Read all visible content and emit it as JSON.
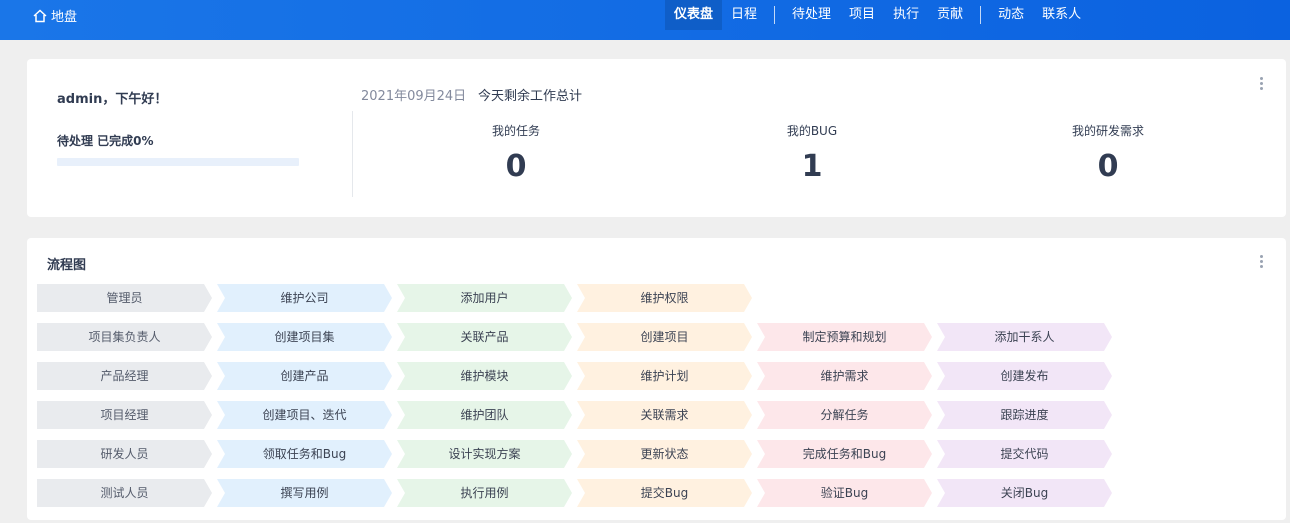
{
  "header": {
    "brand": "地盘",
    "nav": [
      {
        "label": "仪表盘",
        "active": true
      },
      {
        "label": "日程"
      },
      {
        "sep": true
      },
      {
        "label": "待处理"
      },
      {
        "label": "项目"
      },
      {
        "label": "执行"
      },
      {
        "label": "贡献"
      },
      {
        "sep": true
      },
      {
        "label": "动态"
      },
      {
        "label": "联系人"
      }
    ]
  },
  "summary": {
    "greeting": "admin，下午好！",
    "progress_label": "待处理 已完成0%",
    "progress_percent": 0,
    "date": "2021年09月24日",
    "title": "今天剩余工作总计",
    "stats": [
      {
        "label": "我的任务",
        "value": "0"
      },
      {
        "label": "我的BUG",
        "value": "1"
      },
      {
        "label": "我的研发需求",
        "value": "0"
      }
    ]
  },
  "flow": {
    "title": "流程图",
    "rows": [
      {
        "role": "管理员",
        "steps": [
          "维护公司",
          "添加用户",
          "维护权限"
        ]
      },
      {
        "role": "项目集负责人",
        "steps": [
          "创建项目集",
          "关联产品",
          "创建项目",
          "制定预算和规划",
          "添加干系人"
        ]
      },
      {
        "role": "产品经理",
        "steps": [
          "创建产品",
          "维护模块",
          "维护计划",
          "维护需求",
          "创建发布"
        ]
      },
      {
        "role": "项目经理",
        "steps": [
          "创建项目、迭代",
          "维护团队",
          "关联需求",
          "分解任务",
          "跟踪进度"
        ]
      },
      {
        "role": "研发人员",
        "steps": [
          "领取任务和Bug",
          "设计实现方案",
          "更新状态",
          "完成任务和Bug",
          "提交代码"
        ]
      },
      {
        "role": "测试人员",
        "steps": [
          "撰写用例",
          "执行用例",
          "提交Bug",
          "验证Bug",
          "关闭Bug"
        ]
      }
    ],
    "colors": {
      "role": "#e9ebee",
      "steps": [
        "#e1f0fd",
        "#e6f5e8",
        "#fff1e0",
        "#fde7ea",
        "#f2e6f7"
      ]
    }
  }
}
